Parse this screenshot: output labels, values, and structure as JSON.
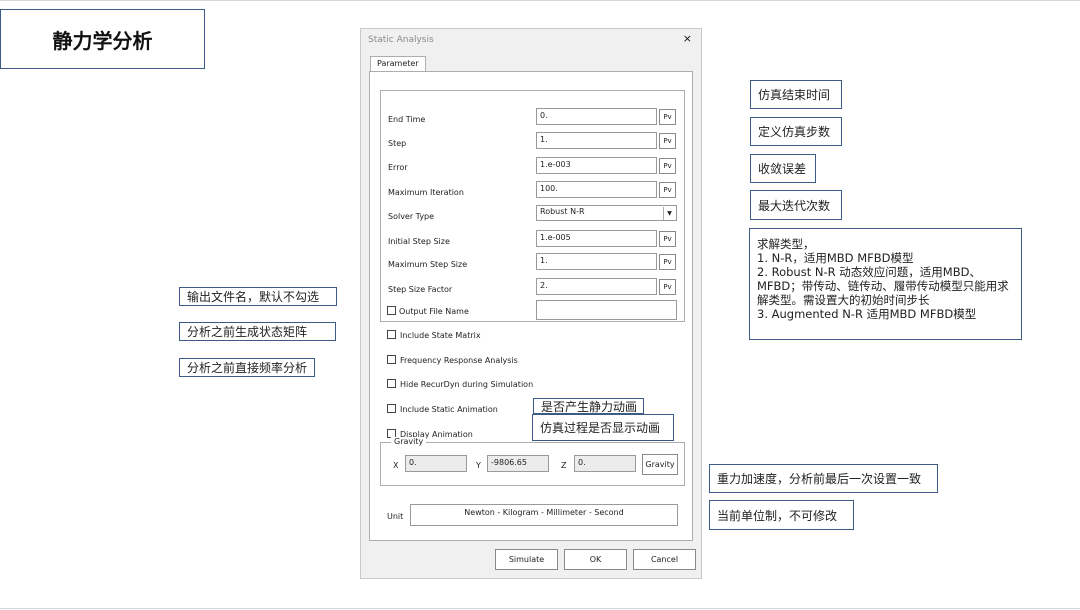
{
  "slide_title": "静力学分析",
  "dialog": {
    "title": "Static Analysis",
    "close": "×",
    "tab": "Parameter",
    "rows": [
      {
        "label": "End Time",
        "value": "0.",
        "pv": "Pv"
      },
      {
        "label": "Step",
        "value": "1.",
        "pv": "Pv"
      },
      {
        "label": "Error",
        "value": "1.e-003",
        "pv": "Pv"
      },
      {
        "label": "Maximum Iteration",
        "value": "100.",
        "pv": "Pv"
      },
      {
        "label": "Solver Type",
        "value": "Robust N-R"
      },
      {
        "label": "Initial Step Size",
        "value": "1.e-005",
        "pv": "Pv"
      },
      {
        "label": "Maximum Step Size",
        "value": "1.",
        "pv": "Pv"
      },
      {
        "label": "Step Size Factor",
        "value": "2.",
        "pv": "Pv"
      }
    ],
    "output_file": {
      "label": "Output File Name",
      "value": ""
    },
    "checkboxes": [
      "Include State Matrix",
      "Frequency Response Analysis",
      "Hide RecurDyn during Simulation",
      "Include Static Animation",
      "Display Animation"
    ],
    "gravity": {
      "title": "Gravity",
      "x_label": "X",
      "x": "0.",
      "y_label": "Y",
      "y": "-9806.65",
      "z_label": "Z",
      "z": "0.",
      "button": "Gravity"
    },
    "unit": {
      "label": "Unit",
      "value": "Newton - Kilogram - Millimeter - Second"
    },
    "buttons": {
      "simulate": "Simulate",
      "ok": "OK",
      "cancel": "Cancel"
    }
  },
  "notes": {
    "end_time": "仿真结束时间",
    "step": "定义仿真步数",
    "error": "收敛误差",
    "max_iter": "最大迭代次数",
    "solver_type": [
      "求解类型，",
      "1.   N-R，适用MBD MFBD模型",
      "2.   Robust N-R 动态效应问题，适用MBD、",
      "MFBD；带传动、链传动、履带传动模型只能用求",
      "解类型。需设置大的初始时间步长",
      "3.   Augmented N-R  适用MBD MFBD模型"
    ],
    "output_file": "输出文件名，默认不勾选",
    "state_matrix": "分析之前生成状态矩阵",
    "frequency": "分析之前直接频率分析",
    "static_anim": "是否产生静力动画",
    "display_anim": "仿真过程是否显示动画",
    "gravity": "重力加速度，分析前最后一次设置一致",
    "unit": "当前单位制，不可修改"
  }
}
